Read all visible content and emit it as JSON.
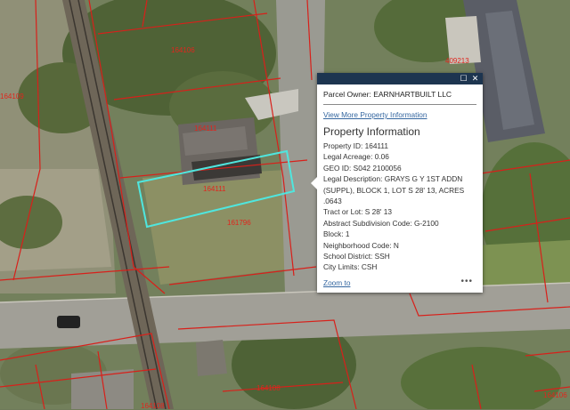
{
  "map": {
    "parcel_labels": [
      "164106",
      "164111",
      "164111",
      "161796",
      "409213",
      "164109",
      "164108",
      "164108",
      "164106"
    ],
    "colors": {
      "parcel_line": "#d8201a",
      "selection": "#4fe6de"
    }
  },
  "popup": {
    "header_icons": [
      "maximize-icon",
      "close-icon"
    ],
    "maximize_glyph": "☐",
    "close_glyph": "✕",
    "owner_text": "Parcel Owner: EARNHARTBUILT LLC",
    "view_more_link": "View More Property Information",
    "section_title": "Property Information",
    "fields": [
      {
        "label": "Property ID",
        "value": "164111"
      },
      {
        "label": "Legal Acreage",
        "value": "0.06"
      },
      {
        "label": "GEO ID",
        "value": "S042 2100056"
      },
      {
        "label": "Legal Description",
        "value": "GRAYS G Y 1ST ADDN (SUPPL), BLOCK 1, LOT S 28' 13, ACRES .0643"
      },
      {
        "label": "Tract or Lot",
        "value": "S 28' 13"
      },
      {
        "label": "Abstract Subdivision Code",
        "value": "G-2100"
      },
      {
        "label": "Block",
        "value": "1"
      },
      {
        "label": "Neighborhood Code",
        "value": "N"
      },
      {
        "label": "School District",
        "value": "SSH"
      },
      {
        "label": "City Limits",
        "value": "CSH"
      }
    ],
    "zoom_link": "Zoom to",
    "more_glyph": "•••"
  }
}
